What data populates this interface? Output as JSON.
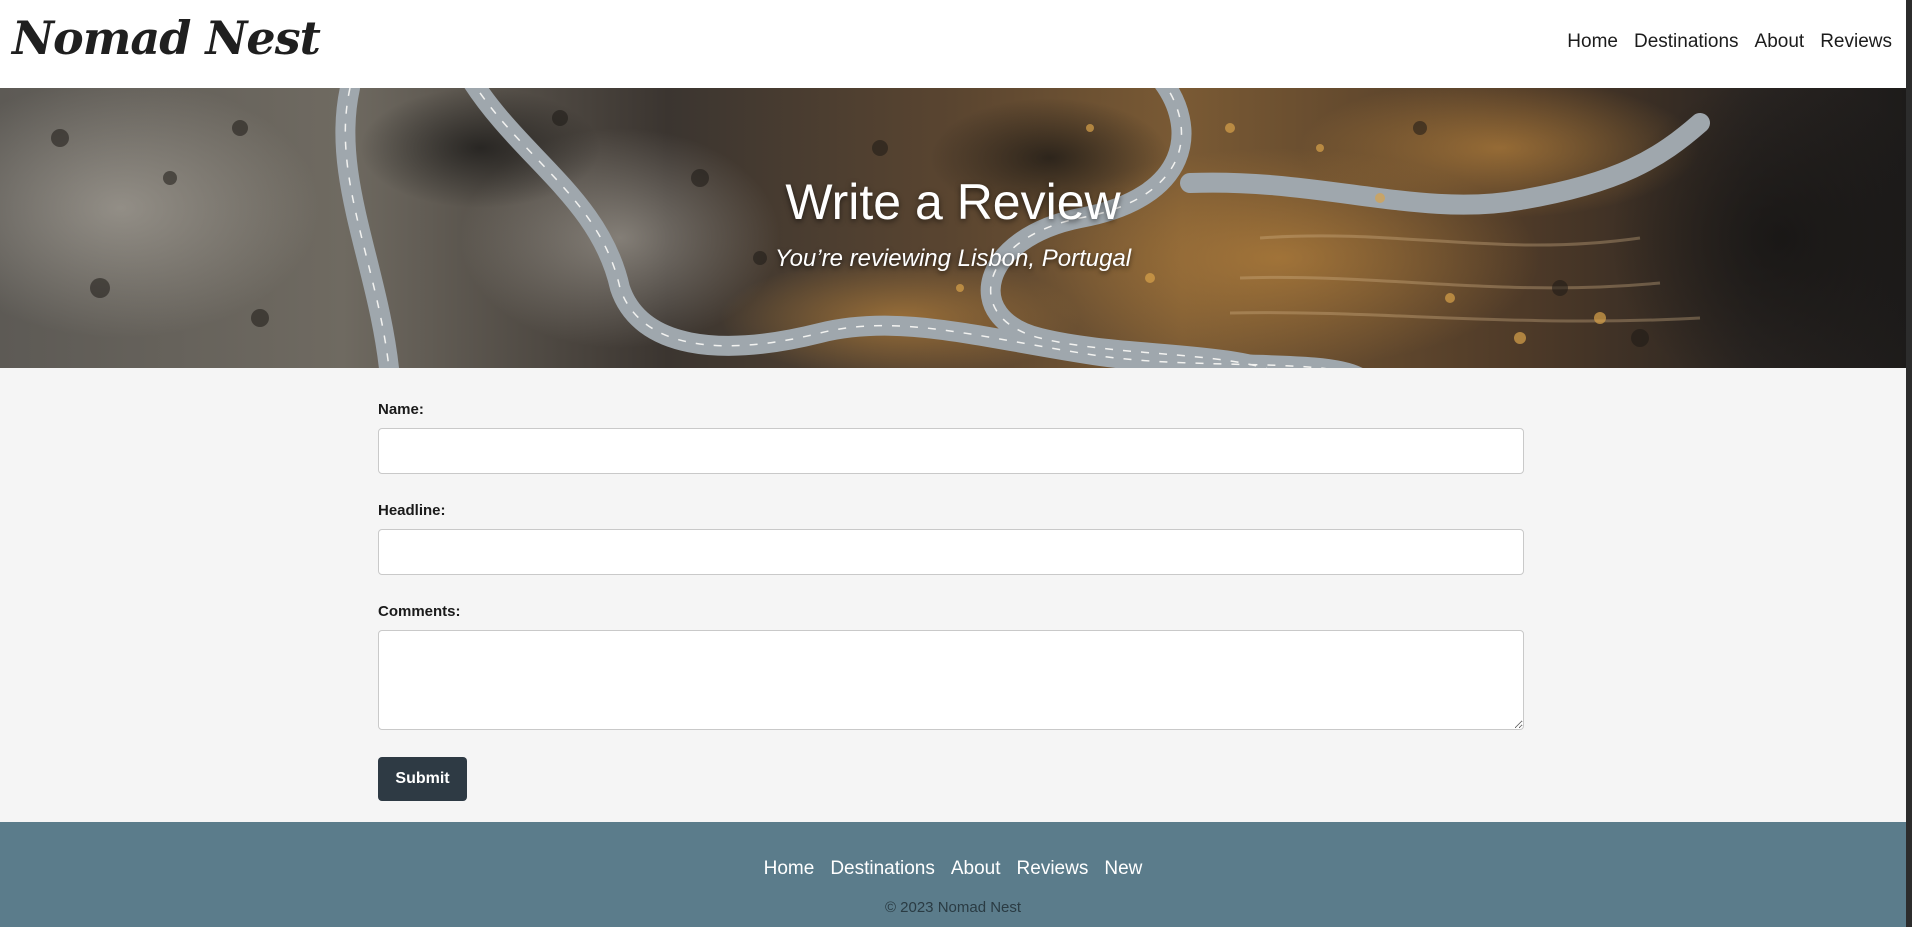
{
  "header": {
    "logo": "Nomad Nest",
    "nav": [
      "Home",
      "Destinations",
      "About",
      "Reviews"
    ]
  },
  "hero": {
    "title": "Write a Review",
    "subtitle": "You’re reviewing Lisbon, Portugal"
  },
  "form": {
    "name_label": "Name:",
    "name_value": "",
    "headline_label": "Headline:",
    "headline_value": "",
    "comments_label": "Comments:",
    "comments_value": "",
    "submit_label": "Submit"
  },
  "footer": {
    "nav": [
      "Home",
      "Destinations",
      "About",
      "Reviews",
      "New"
    ],
    "copyright": "© 2023 Nomad Nest"
  },
  "colors": {
    "header_bg": "#ffffff",
    "content_bg": "#f5f5f5",
    "footer_bg": "#5b7c8b",
    "button_bg": "#2e3a44",
    "text_dark": "#1c1c1c"
  }
}
